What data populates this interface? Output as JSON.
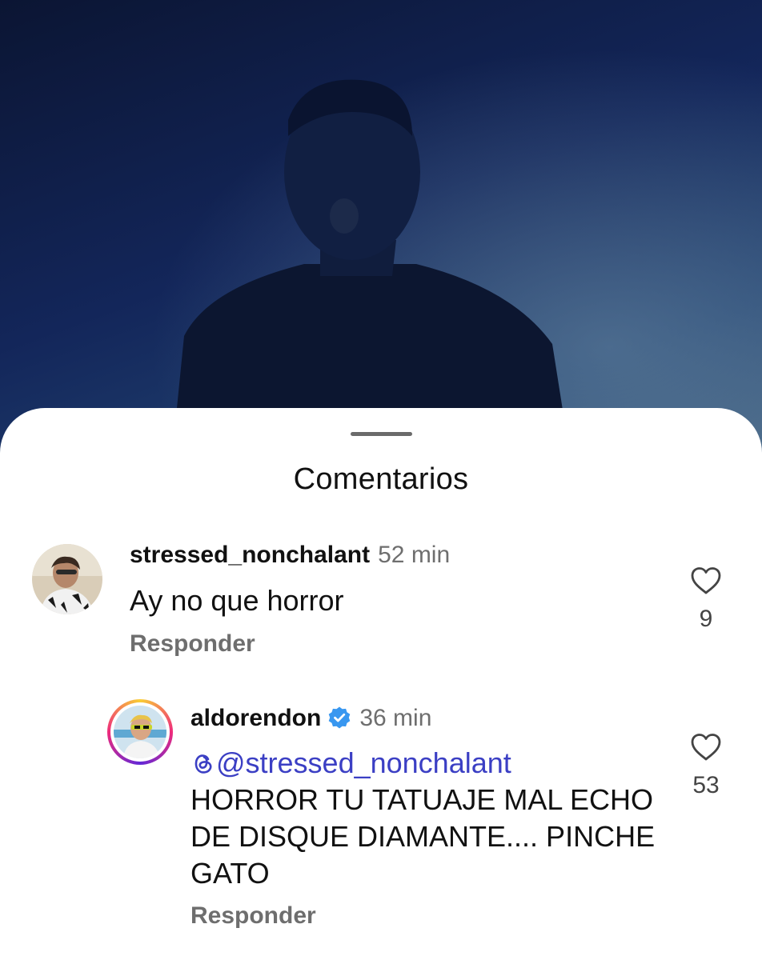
{
  "sheet": {
    "title": "Comentarios"
  },
  "comments": [
    {
      "username": "stressed_nonchalant",
      "time": "52 min",
      "text": "Ay no que horror",
      "reply_label": "Responder",
      "likes": "9"
    },
    {
      "username": "aldorendon",
      "verified": true,
      "time": "36 min",
      "mention": "@stressed_nonchalant",
      "text": "HORROR TU TATUAJE MAL ECHO DE DISQUE DIAMANTE.... PINCHE GATO",
      "reply_label": "Responder",
      "likes": "53"
    }
  ],
  "colors": {
    "mention": "#3b3fc4",
    "verified_badge": "#3897f0",
    "muted_text": "#6e6e6e"
  },
  "icons": {
    "like": "heart-outline-icon",
    "verified": "verified-badge-icon",
    "threads": "threads-logo-icon"
  }
}
